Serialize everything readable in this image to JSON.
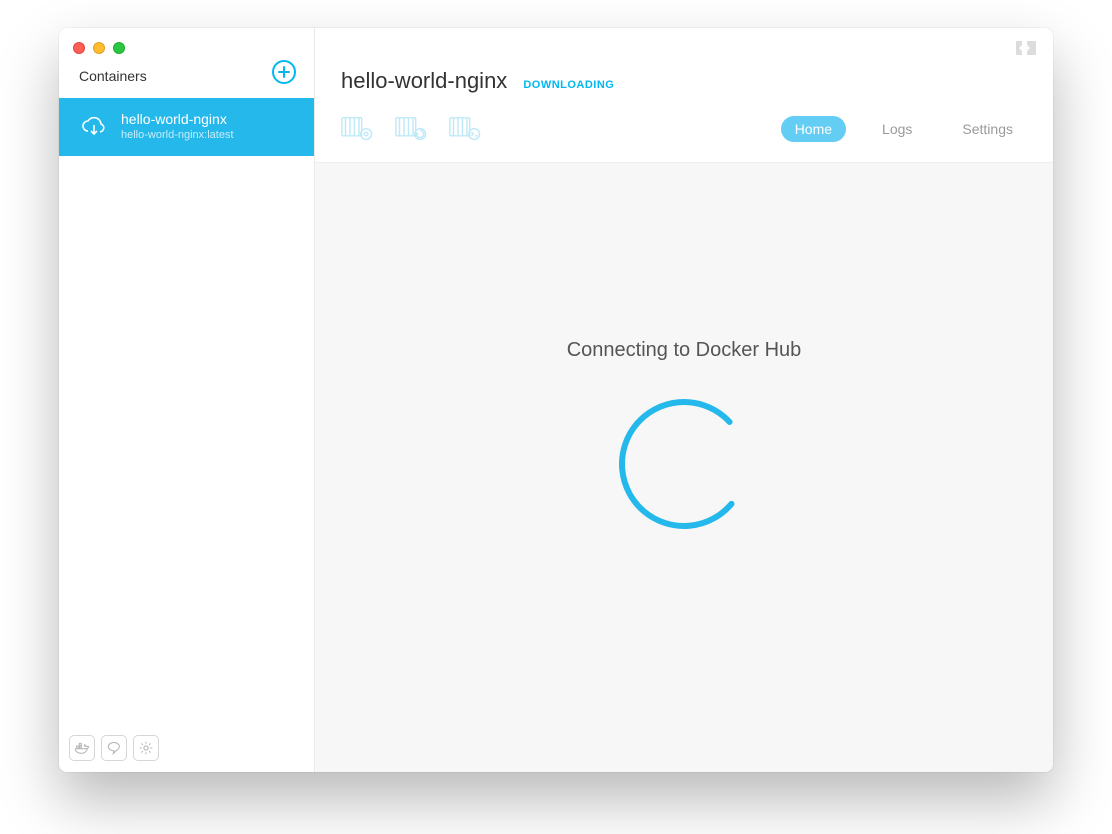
{
  "sidebar": {
    "title": "Containers",
    "items": [
      {
        "name": "hello-world-nginx",
        "subtitle": "hello-world-nginx:latest"
      }
    ]
  },
  "header": {
    "title": "hello-world-nginx",
    "status": "DOWNLOADING"
  },
  "tabs": {
    "home": "Home",
    "logs": "Logs",
    "settings": "Settings",
    "active": "home"
  },
  "body": {
    "message": "Connecting to Docker Hub"
  },
  "colors": {
    "accent": "#24b8eb"
  }
}
